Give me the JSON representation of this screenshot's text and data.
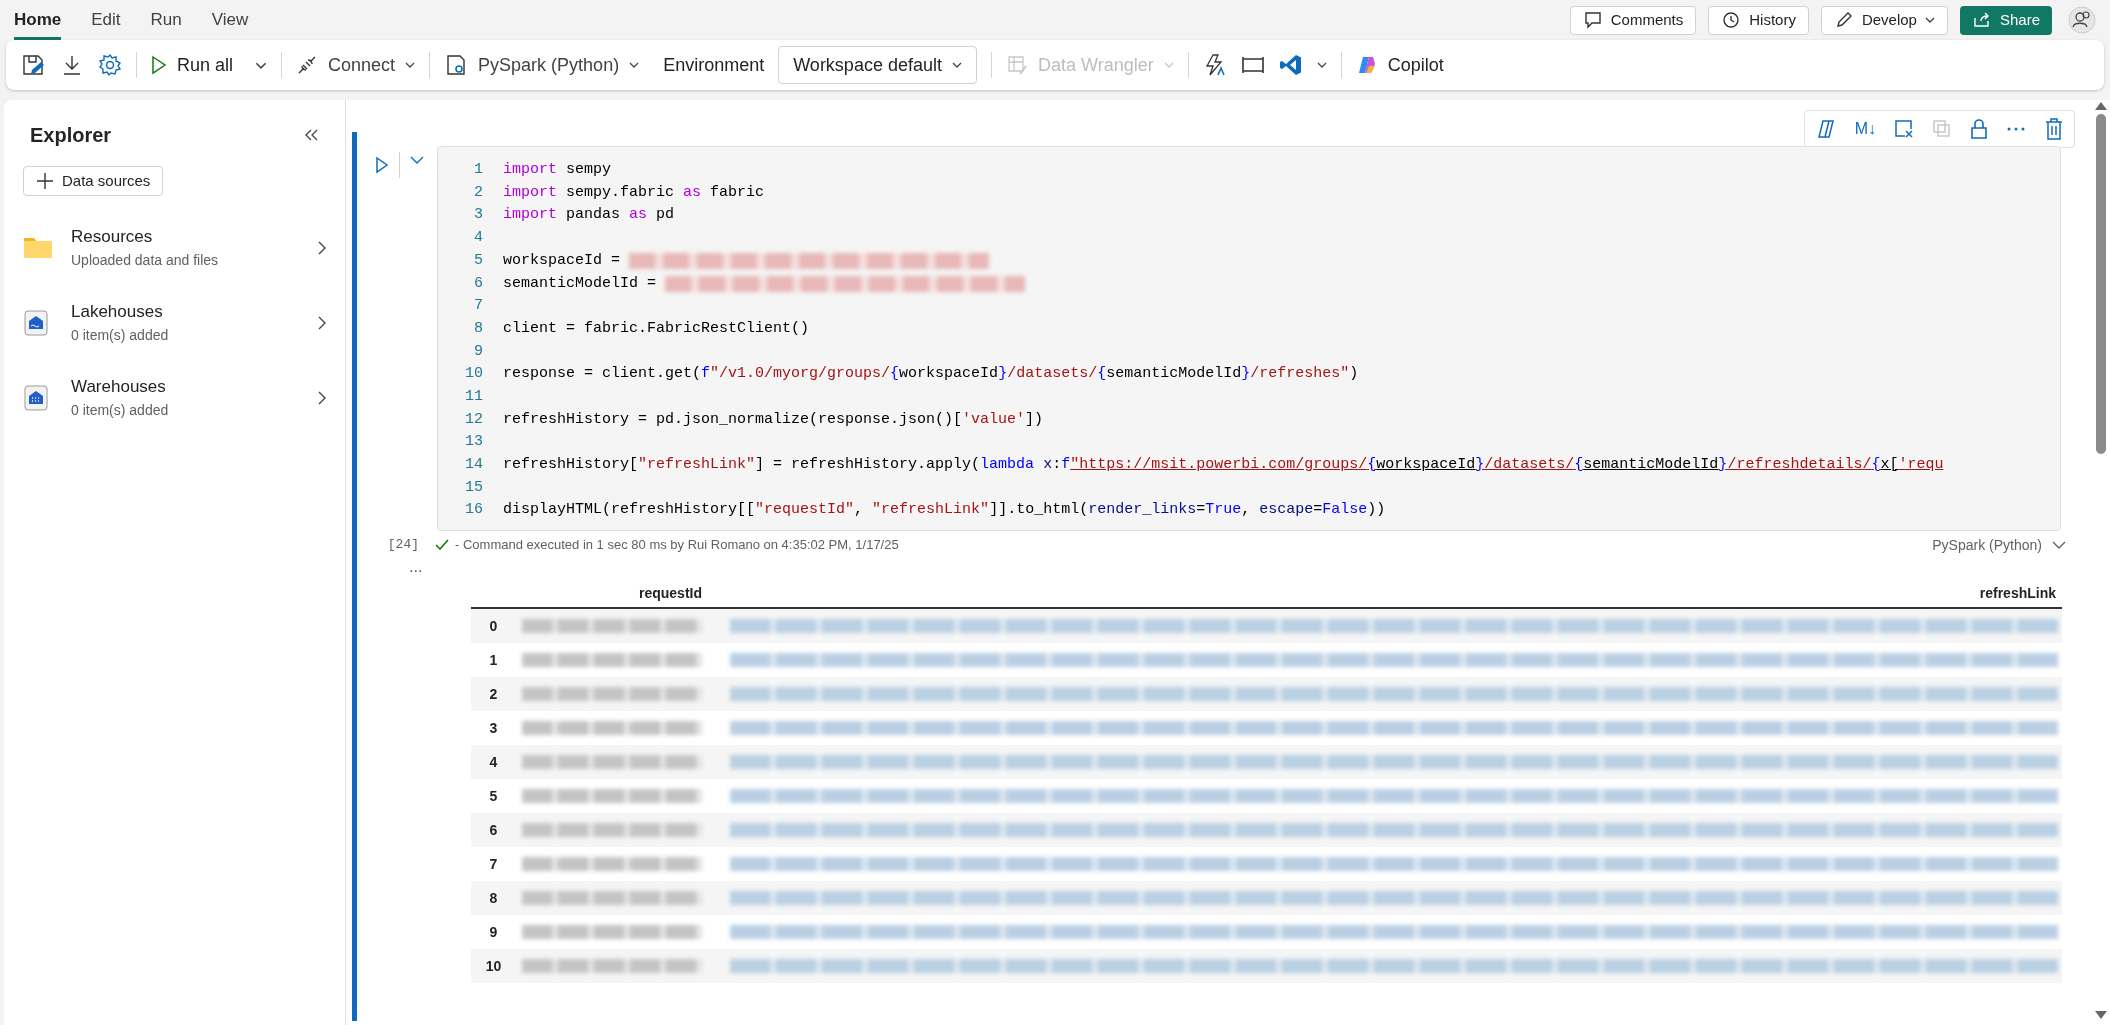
{
  "menu_tabs": [
    {
      "label": "Home",
      "selected": true
    },
    {
      "label": "Edit",
      "selected": false
    },
    {
      "label": "Run",
      "selected": false
    },
    {
      "label": "View",
      "selected": false
    }
  ],
  "header_buttons": [
    {
      "label": "Comments",
      "kind": "comments"
    },
    {
      "label": "History",
      "kind": "history"
    },
    {
      "label": "Develop",
      "kind": "develop"
    },
    {
      "label": "Share",
      "kind": "share"
    }
  ],
  "toolbar": {
    "run_all": "Run all",
    "connect": "Connect",
    "language": "PySpark (Python)",
    "environment_label": "Environment",
    "environment": "Workspace default",
    "data_wrangler": {
      "label": "Data Wrangler",
      "disabled": true
    },
    "copilot": "Copilot"
  },
  "explorer": {
    "title": "Explorer",
    "add_button": "Data sources",
    "items": [
      {
        "kind": "folder",
        "title": "Resources",
        "subtitle": "Uploaded data and files"
      },
      {
        "kind": "lakehouse",
        "title": "Lakehouses",
        "subtitle": "0 item(s) added"
      },
      {
        "kind": "warehouse",
        "title": "Warehouses",
        "subtitle": "0 item(s) added"
      }
    ]
  },
  "cell_toolbar": {
    "markdown_label": "M↓"
  },
  "cell": {
    "lines": [
      {
        "number": "1",
        "tokens": [
          {
            "kind": "kw",
            "text": "import"
          },
          {
            "kind": "plain",
            "text": " sempy"
          }
        ]
      },
      {
        "number": "2",
        "tokens": [
          {
            "kind": "kw",
            "text": "import"
          },
          {
            "kind": "plain",
            "text": " sempy.fabric "
          },
          {
            "kind": "kw",
            "text": "as"
          },
          {
            "kind": "plain",
            "text": " fabric"
          }
        ]
      },
      {
        "number": "3",
        "tokens": [
          {
            "kind": "kw",
            "text": "import"
          },
          {
            "kind": "plain",
            "text": " pandas "
          },
          {
            "kind": "kw",
            "text": "as"
          },
          {
            "kind": "plain",
            "text": " pd"
          }
        ]
      },
      {
        "number": "4"
      },
      {
        "number": "5",
        "tokens": [
          {
            "kind": "plain",
            "text": "workspaceId = "
          },
          {
            "kind": "redacted"
          }
        ]
      },
      {
        "number": "6",
        "tokens": [
          {
            "kind": "plain",
            "text": "semanticModelId = "
          },
          {
            "kind": "redacted"
          }
        ]
      },
      {
        "number": "7"
      },
      {
        "number": "8",
        "tokens": [
          {
            "kind": "plain",
            "text": "client = fabric.FabricRestClient()"
          }
        ]
      },
      {
        "number": "9"
      },
      {
        "number": "10",
        "tokens": [
          {
            "kind": "plain",
            "text": "response = client.get("
          },
          {
            "kind": "const",
            "text": "f"
          },
          {
            "kind": "str",
            "text": "\"/v1.0/myorg/groups/"
          },
          {
            "kind": "const",
            "text": "{"
          },
          {
            "kind": "plain",
            "text": "workspaceId"
          },
          {
            "kind": "const",
            "text": "}"
          },
          {
            "kind": "str",
            "text": "/datasets/"
          },
          {
            "kind": "const",
            "text": "{"
          },
          {
            "kind": "plain",
            "text": "semanticModelId"
          },
          {
            "kind": "const",
            "text": "}"
          },
          {
            "kind": "str",
            "text": "/refreshes\""
          },
          {
            "kind": "plain",
            "text": ")"
          }
        ]
      },
      {
        "number": "11"
      },
      {
        "number": "12",
        "tokens": [
          {
            "kind": "plain",
            "text": "refreshHistory = pd.json_normalize(response.json()["
          },
          {
            "kind": "str",
            "text": "'value'"
          },
          {
            "kind": "plain",
            "text": "])"
          }
        ]
      },
      {
        "number": "13"
      },
      {
        "number": "14",
        "tokens": [
          {
            "kind": "plain",
            "text": "refreshHistory["
          },
          {
            "kind": "str",
            "text": "\"refreshLink\""
          },
          {
            "kind": "plain",
            "text": "] = refreshHistory.apply("
          },
          {
            "kind": "const",
            "text": "lambda"
          },
          {
            "kind": "param",
            "text": " x"
          },
          {
            "kind": "plain",
            "text": ":"
          },
          {
            "kind": "const",
            "text": "f"
          },
          {
            "kind": "url",
            "text": "\"https://msit.powerbi.com/groups/"
          },
          {
            "kind": "urlbrace",
            "text": "{"
          },
          {
            "kind": "urlvar",
            "text": "workspaceId"
          },
          {
            "kind": "urlbrace",
            "text": "}"
          },
          {
            "kind": "url",
            "text": "/datasets/"
          },
          {
            "kind": "urlbrace",
            "text": "{"
          },
          {
            "kind": "urlvar",
            "text": "semanticModelId"
          },
          {
            "kind": "urlbrace",
            "text": "}"
          },
          {
            "kind": "url",
            "text": "/refreshdetails/"
          },
          {
            "kind": "urlbrace",
            "text": "{"
          },
          {
            "kind": "urlvar",
            "text": "x["
          },
          {
            "kind": "url",
            "text": "'requ"
          }
        ]
      },
      {
        "number": "15"
      },
      {
        "number": "16",
        "tokens": [
          {
            "kind": "plain",
            "text": "displayHTML(refreshHistory[["
          },
          {
            "kind": "str",
            "text": "\"requestId\""
          },
          {
            "kind": "plain",
            "text": ", "
          },
          {
            "kind": "str",
            "text": "\"refreshLink\""
          },
          {
            "kind": "plain",
            "text": "]].to_html("
          },
          {
            "kind": "param",
            "text": "render_links"
          },
          {
            "kind": "plain",
            "text": "="
          },
          {
            "kind": "const",
            "text": "True"
          },
          {
            "kind": "plain",
            "text": ", "
          },
          {
            "kind": "param",
            "text": "escape"
          },
          {
            "kind": "plain",
            "text": "="
          },
          {
            "kind": "const",
            "text": "False"
          },
          {
            "kind": "plain",
            "text": "))"
          }
        ]
      }
    ],
    "execution_count": "[24]",
    "succeeded": true,
    "status": "- Command executed in 1 sec 80 ms by Rui Romano on 4:35:02 PM, 1/17/25",
    "language": "PySpark (Python)"
  },
  "output": {
    "more": "...",
    "columns": [
      "requestId",
      "refreshLink"
    ],
    "rows": [
      {
        "index": "0"
      },
      {
        "index": "1"
      },
      {
        "index": "2"
      },
      {
        "index": "3"
      },
      {
        "index": "4"
      },
      {
        "index": "5"
      },
      {
        "index": "6"
      },
      {
        "index": "7"
      },
      {
        "index": "8"
      },
      {
        "index": "9"
      },
      {
        "index": "10"
      }
    ]
  }
}
